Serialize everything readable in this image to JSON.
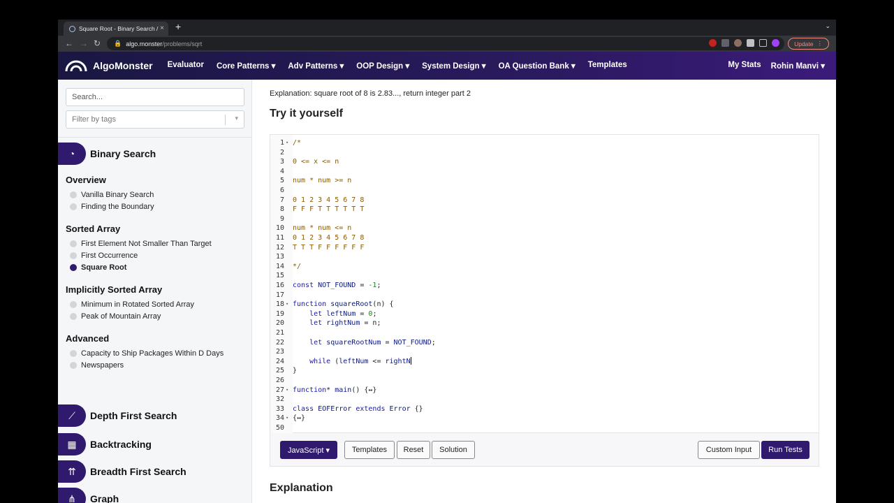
{
  "browser": {
    "tab_title": "Square Root - Binary Search /",
    "tab_close": "×",
    "new_tab": "+",
    "url_host": "algo.monster",
    "url_path": "/problems/sqrt",
    "update_label": "Update"
  },
  "site": {
    "brand": "AlgoMonster",
    "nav": [
      "Evaluator",
      "Core Patterns ▾",
      "Adv Patterns ▾",
      "OOP Design ▾",
      "System Design ▾",
      "OA Question Bank ▾",
      "Templates"
    ],
    "my_stats": "My Stats",
    "user": "Rohin Manvi ▾"
  },
  "sidebar": {
    "search_placeholder": "Search...",
    "filter_placeholder": "Filter by tags",
    "current_topic": "Binary Search",
    "sections": [
      {
        "title": "Overview",
        "items": [
          "Vanilla Binary Search",
          "Finding the Boundary"
        ]
      },
      {
        "title": "Sorted Array",
        "items": [
          "First Element Not Smaller Than Target",
          "First Occurrence",
          "Square Root"
        ]
      },
      {
        "title": "Implicitly Sorted Array",
        "items": [
          "Minimum in Rotated Sorted Array",
          "Peak of Mountain Array"
        ]
      },
      {
        "title": "Advanced",
        "items": [
          "Capacity to Ship Packages Within D Days",
          "Newspapers"
        ]
      }
    ],
    "other_topics": [
      "Depth First Search",
      "Backtracking",
      "Breadth First Search",
      "Graph"
    ],
    "active_item": "Square Root"
  },
  "main": {
    "explanation_line": "Explanation: square root of 8 is 2.83..., return integer part 2",
    "try_title": "Try it yourself",
    "explanation_title": "Explanation",
    "code_lines": [
      {
        "n": "1",
        "t": "/*",
        "k": "comment",
        "f": true
      },
      {
        "n": "2",
        "t": "",
        "k": "comment"
      },
      {
        "n": "3",
        "t": "0 <= x <= n",
        "k": "comment"
      },
      {
        "n": "4",
        "t": "",
        "k": "comment"
      },
      {
        "n": "5",
        "t": "num * num >= n",
        "k": "comment"
      },
      {
        "n": "6",
        "t": "",
        "k": "comment"
      },
      {
        "n": "7",
        "t": "0 1 2 3 4 5 6 7 8",
        "k": "comment"
      },
      {
        "n": "8",
        "t": "F F F T T T T T T",
        "k": "comment"
      },
      {
        "n": "9",
        "t": "",
        "k": "comment"
      },
      {
        "n": "10",
        "t": "num * num <= n",
        "k": "comment"
      },
      {
        "n": "11",
        "t": "0 1 2 3 4 5 6 7 8",
        "k": "comment"
      },
      {
        "n": "12",
        "t": "T T T F F F F F F",
        "k": "comment"
      },
      {
        "n": "13",
        "t": "",
        "k": "comment"
      },
      {
        "n": "14",
        "t": "*/",
        "k": "comment"
      },
      {
        "n": "15",
        "t": "",
        "k": "plain"
      },
      {
        "n": "16",
        "t": "const NOT_FOUND = -1;",
        "k": "code"
      },
      {
        "n": "17",
        "t": "",
        "k": "plain"
      },
      {
        "n": "18",
        "t": "function squareRoot(n) {",
        "k": "code",
        "f": true
      },
      {
        "n": "19",
        "t": "    let leftNum = 0;",
        "k": "code"
      },
      {
        "n": "20",
        "t": "    let rightNum = n;",
        "k": "code"
      },
      {
        "n": "21",
        "t": "",
        "k": "plain"
      },
      {
        "n": "22",
        "t": "    let squareRootNum = NOT_FOUND;",
        "k": "code"
      },
      {
        "n": "23",
        "t": "",
        "k": "plain"
      },
      {
        "n": "24",
        "t": "    while (leftNum <= rightN",
        "k": "code",
        "cursor": true
      },
      {
        "n": "25",
        "t": "}",
        "k": "code"
      },
      {
        "n": "26",
        "t": "",
        "k": "plain"
      },
      {
        "n": "27",
        "t": "function* main() {↔}",
        "k": "code",
        "f": true
      },
      {
        "n": "32",
        "t": "",
        "k": "plain"
      },
      {
        "n": "33",
        "t": "class EOFError extends Error {}",
        "k": "code"
      },
      {
        "n": "34",
        "t": "{↔}",
        "k": "code",
        "f": true
      },
      {
        "n": "50",
        "t": "",
        "k": "plain"
      }
    ],
    "buttons": {
      "language": "JavaScript ▾",
      "templates": "Templates",
      "reset": "Reset",
      "solution": "Solution",
      "custom_input": "Custom Input",
      "run_tests": "Run Tests"
    }
  },
  "colors": {
    "brand": "#2f1a6e",
    "nav_bg": "#1a1742"
  }
}
